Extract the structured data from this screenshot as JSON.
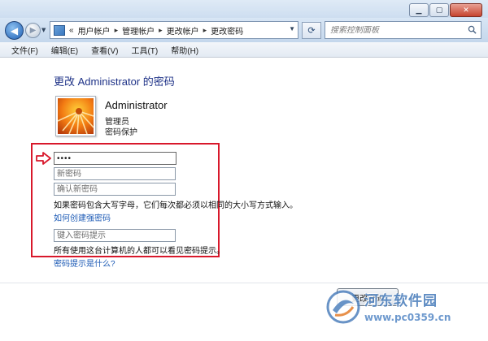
{
  "window": {
    "caption_buttons": [
      "minimize",
      "maximize",
      "close"
    ]
  },
  "breadcrumb": {
    "overflow": "«",
    "items": [
      "用户帐户",
      "管理帐户",
      "更改帐户",
      "更改密码"
    ]
  },
  "search": {
    "placeholder": "搜索控制面板"
  },
  "menu": [
    "文件(F)",
    "编辑(E)",
    "查看(V)",
    "工具(T)",
    "帮助(H)"
  ],
  "page": {
    "title": "更改 Administrator 的密码"
  },
  "account": {
    "name": "Administrator",
    "role": "管理员",
    "status": "密码保护"
  },
  "form": {
    "current_password_value": "••••",
    "new_password_placeholder": "新密码",
    "confirm_password_placeholder": "确认新密码",
    "case_note": "如果密码包含大写字母，它们每次都必须以相同的大小写方式输入。",
    "strong_password_link": "如何创建强密码",
    "hint_placeholder": "键入密码提示",
    "hint_visibility_note": "所有使用这台计算机的人都可以看见密码提示。",
    "hint_help_link": "密码提示是什么?",
    "change_button": "更改密码"
  },
  "watermark": {
    "title": "河东软件园",
    "url": "www.pc0359.cn"
  },
  "colors": {
    "title_blue": "#1e3287",
    "link_blue": "#1c5ab5",
    "highlight_red": "#d8182b"
  }
}
